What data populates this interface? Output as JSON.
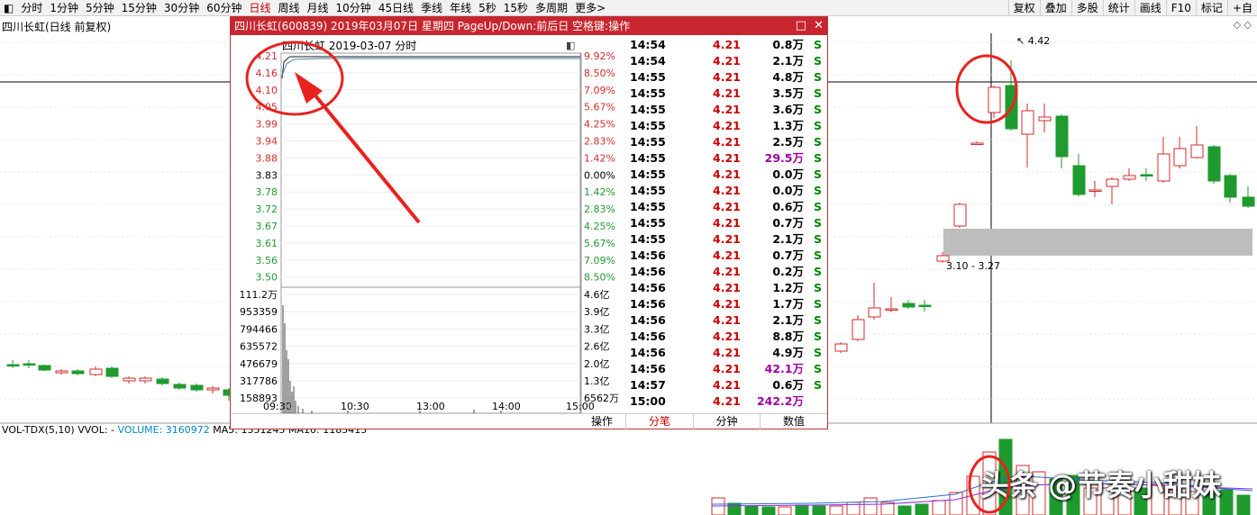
{
  "toolbar": {
    "periods": [
      "分时",
      "1分钟",
      "5分钟",
      "15分钟",
      "30分钟",
      "60分钟",
      "日线",
      "周线",
      "月线",
      "10分钟",
      "45日线",
      "季线",
      "年线",
      "5秒",
      "15秒",
      "多周期",
      "更多>"
    ],
    "active_period": "日线",
    "right_buttons": [
      "复权",
      "叠加",
      "多股",
      "统计",
      "画线",
      "F10",
      "标记",
      "+自"
    ]
  },
  "chart_title": "四川长虹(日线 前复权)",
  "price_marker": "4.42",
  "range_label": "3.10 - 3.27",
  "vol_indicator": {
    "name": "VOL-TDX(5,10)",
    "vvol": "VVOL: -",
    "volume": "VOLUME: 3160972",
    "ma5": "MA5: 1351245",
    "ma10": "MA10: 1185415"
  },
  "watermark": "头条 @节奏小甜妹",
  "popup": {
    "title": "四川长虹(600839) 2019年03月07日 星期四 PageUp/Down:前后日 空格键:操作",
    "subtitle": "四川长虹  2019-03-07 分时",
    "price_levels": [
      "4.21",
      "4.16",
      "4.10",
      "4.05",
      "3.99",
      "3.94",
      "3.88",
      "3.83",
      "3.78",
      "3.72",
      "3.67",
      "3.61",
      "3.56",
      "3.50"
    ],
    "pct_levels": [
      "9.92%",
      "8.50%",
      "7.09%",
      "5.67%",
      "4.25%",
      "2.83%",
      "1.42%",
      "0.00%",
      "1.42%",
      "2.83%",
      "4.25%",
      "5.67%",
      "7.09%",
      "8.50%"
    ],
    "vol_levels": [
      "111.2万",
      "953359",
      "794466",
      "635572",
      "476679",
      "317786",
      "158893"
    ],
    "amt_levels": [
      "4.6亿",
      "3.9亿",
      "3.3亿",
      "2.6亿",
      "2.0亿",
      "1.3亿",
      "6562万"
    ],
    "time_labels": [
      "09:30",
      "10:30",
      "13:00",
      "14:00",
      "15:00"
    ],
    "operate_label": "操作",
    "footer_tabs": [
      "分笔",
      "分钟",
      "数值"
    ],
    "trades": [
      {
        "time": "14:54",
        "price": "4.21",
        "vol": "0.8万",
        "flag": "S"
      },
      {
        "time": "14:54",
        "price": "4.21",
        "vol": "2.1万",
        "flag": "S"
      },
      {
        "time": "14:55",
        "price": "4.21",
        "vol": "4.8万",
        "flag": "S"
      },
      {
        "time": "14:55",
        "price": "4.21",
        "vol": "3.5万",
        "flag": "S"
      },
      {
        "time": "14:55",
        "price": "4.21",
        "vol": "3.6万",
        "flag": "S"
      },
      {
        "time": "14:55",
        "price": "4.21",
        "vol": "1.3万",
        "flag": "S"
      },
      {
        "time": "14:55",
        "price": "4.21",
        "vol": "2.5万",
        "flag": "S"
      },
      {
        "time": "14:55",
        "price": "4.21",
        "vol": "29.5万",
        "flag": "S",
        "big": true
      },
      {
        "time": "14:55",
        "price": "4.21",
        "vol": "0.0万",
        "flag": "S"
      },
      {
        "time": "14:55",
        "price": "4.21",
        "vol": "0.0万",
        "flag": "S"
      },
      {
        "time": "14:55",
        "price": "4.21",
        "vol": "0.6万",
        "flag": "S"
      },
      {
        "time": "14:55",
        "price": "4.21",
        "vol": "0.7万",
        "flag": "S"
      },
      {
        "time": "14:55",
        "price": "4.21",
        "vol": "2.1万",
        "flag": "S"
      },
      {
        "time": "14:56",
        "price": "4.21",
        "vol": "0.7万",
        "flag": "S"
      },
      {
        "time": "14:56",
        "price": "4.21",
        "vol": "0.2万",
        "flag": "S"
      },
      {
        "time": "14:56",
        "price": "4.21",
        "vol": "1.2万",
        "flag": "S"
      },
      {
        "time": "14:56",
        "price": "4.21",
        "vol": "1.7万",
        "flag": "S"
      },
      {
        "time": "14:56",
        "price": "4.21",
        "vol": "2.1万",
        "flag": "S"
      },
      {
        "time": "14:56",
        "price": "4.21",
        "vol": "8.8万",
        "flag": "S"
      },
      {
        "time": "14:56",
        "price": "4.21",
        "vol": "4.9万",
        "flag": "S"
      },
      {
        "time": "14:56",
        "price": "4.21",
        "vol": "42.1万",
        "flag": "S",
        "big": true
      },
      {
        "time": "14:57",
        "price": "4.21",
        "vol": "0.6万",
        "flag": "S"
      },
      {
        "time": "15:00",
        "price": "4.21",
        "vol": "242.2万",
        "flag": "",
        "big": true
      }
    ]
  },
  "colors": {
    "up": "#d42a2a",
    "down": "#1f9a2e",
    "title_bar": "#c8262f",
    "annotation": "#e8221e"
  }
}
